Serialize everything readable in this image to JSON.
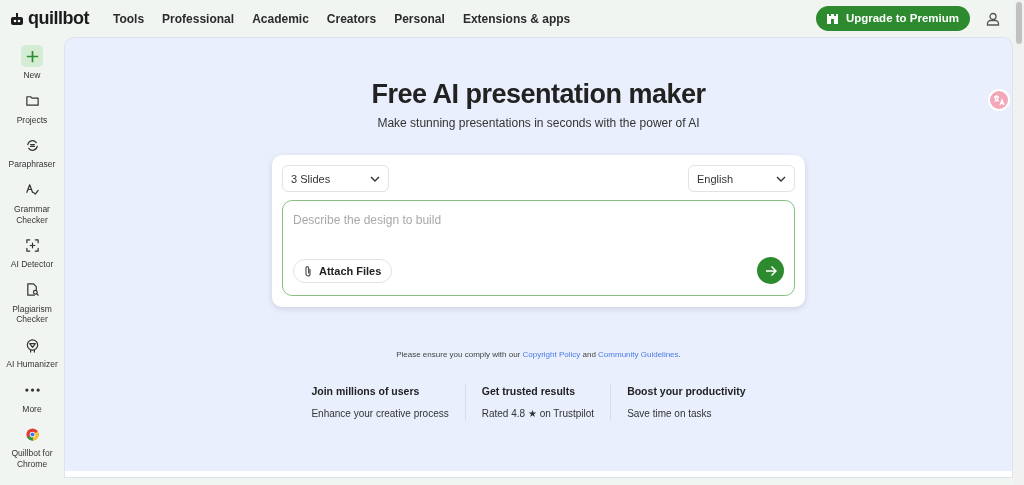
{
  "brand": {
    "name": "quillbot"
  },
  "nav": [
    "Tools",
    "Professional",
    "Academic",
    "Creators",
    "Personal",
    "Extensions & apps"
  ],
  "upgrade_button": {
    "label": "Upgrade to Premium"
  },
  "sidebar": {
    "items": [
      {
        "label": "New",
        "highlighted": true
      },
      {
        "label": "Projects",
        "highlighted": false
      },
      {
        "label": "Paraphraser",
        "highlighted": false
      },
      {
        "label": "Grammar Checker",
        "highlighted": false
      },
      {
        "label": "AI Detector",
        "highlighted": false
      },
      {
        "label": "Plagiarism Checker",
        "highlighted": false
      },
      {
        "label": "AI Humanizer",
        "highlighted": false
      },
      {
        "label": "More",
        "highlighted": false
      },
      {
        "label": "Quillbot for Chrome",
        "highlighted": false
      }
    ]
  },
  "hero": {
    "title": "Free AI presentation maker",
    "subtitle": "Make stunning presentations in seconds with the power of AI"
  },
  "form": {
    "slides": "3 Slides",
    "language": "English",
    "prompt": {
      "placeholder": "Describe the design to build"
    },
    "attach_button": "Attach Files"
  },
  "notice": {
    "parts": [
      {
        "kind": "text",
        "text": "Please ensure you comply with our "
      },
      {
        "kind": "link",
        "text": "Copyright Policy"
      },
      {
        "kind": "text",
        "text": " and "
      },
      {
        "kind": "link",
        "text": "Community Guidelines"
      },
      {
        "kind": "text",
        "text": "."
      }
    ]
  },
  "features": [
    {
      "title": "Join millions of users",
      "text": "Enhance your creative process"
    },
    {
      "title": "Get trusted results",
      "text": "Rated 4.8 ★ on Trustpilot"
    },
    {
      "title": "Boost your productivity",
      "text": "Save time on tasks"
    }
  ]
}
